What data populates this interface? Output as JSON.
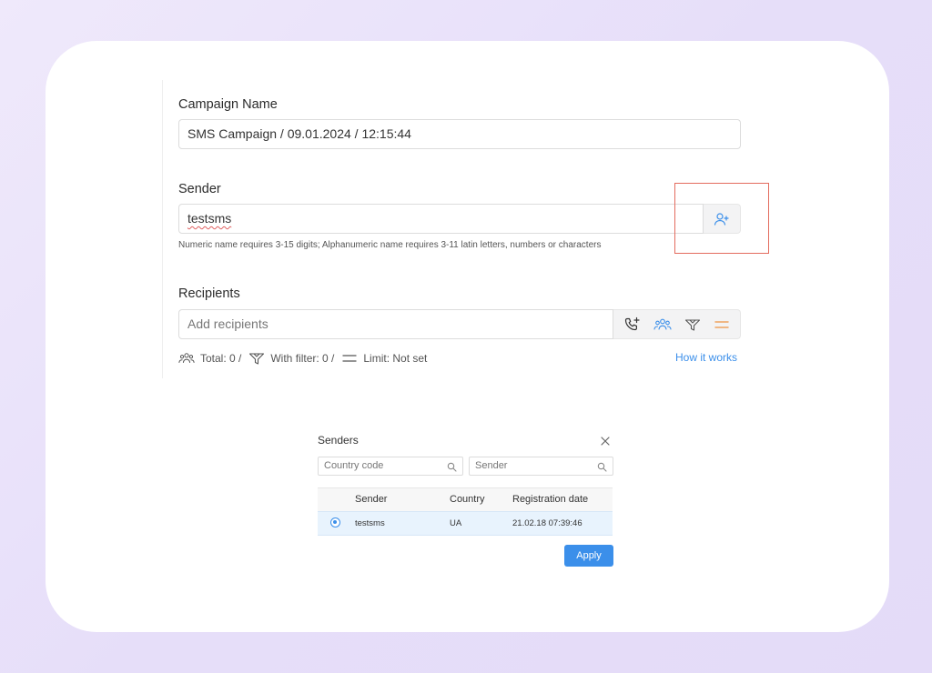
{
  "campaign": {
    "label": "Campaign Name",
    "value": "SMS Campaign / 09.01.2024 / 12:15:44"
  },
  "sender": {
    "label": "Sender",
    "value": "testsms",
    "hint": "Numeric name requires 3-15 digits; Alphanumeric name requires 3-11 latin letters, numbers or characters",
    "add_icon": "user-plus-icon"
  },
  "recipients": {
    "label": "Recipients",
    "placeholder": "Add recipients",
    "tool_icons": [
      "phone-plus-icon",
      "group-icon",
      "filter-icon",
      "limit-icon"
    ],
    "stats": {
      "total": "Total: 0 /",
      "with_filter": "With filter: 0 /",
      "limit": "Limit: Not set"
    },
    "how_it_works": "How it works"
  },
  "senders_modal": {
    "title": "Senders",
    "country_code_placeholder": "Country code",
    "sender_placeholder": "Sender",
    "columns": [
      "Sender",
      "Country",
      "Registration date"
    ],
    "rows": [
      {
        "sender": "testsms",
        "country": "UA",
        "registration_date": "21.02.18 07:39:46",
        "selected": true
      }
    ],
    "apply_label": "Apply"
  },
  "colors": {
    "accent": "#3b8fea",
    "highlight": "#e36b5e",
    "limit_icon": "#f0a35e"
  }
}
